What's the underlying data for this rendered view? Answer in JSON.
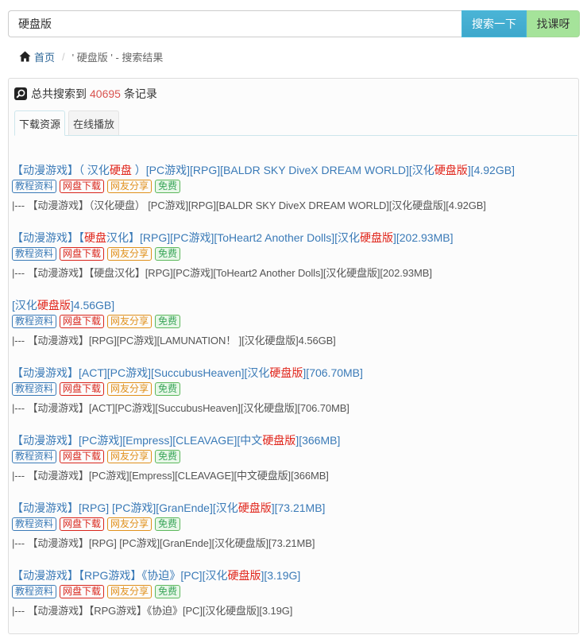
{
  "search": {
    "value": "硬盘版",
    "search_button": "搜索一下",
    "course_button": "找课呀"
  },
  "breadcrumb": {
    "home_label": "首页",
    "separator": "/",
    "current": "' 硬盘版 ' - 搜索结果"
  },
  "summary": {
    "prefix": "总共搜索到",
    "count": "40695",
    "suffix": "条记录"
  },
  "tabs": [
    {
      "label": "下载资源",
      "active": true
    },
    {
      "label": "在线播放",
      "active": false
    }
  ],
  "tag_labels": {
    "tutorial": "教程资料",
    "netdisk": "网盘下载",
    "share": "网友分享",
    "free": "免费"
  },
  "results": [
    {
      "title_pre": "【动漫游戏】（ 汉化",
      "title_hl": "硬盘",
      "title_post": " ）[PC游戏][RPG][BALDR SKY DiveX DREAM WORLD][汉化",
      "title_hl2": "硬盘版",
      "title_post2": "][4.92GB]",
      "desc": "|--- 【动漫游戏】（汉化硬盘） [PC游戏][RPG][BALDR SKY DiveX DREAM WORLD][汉化硬盘版][4.92GB]"
    },
    {
      "title_pre": "【动漫游戏】【",
      "title_hl": "硬盘",
      "title_post": "汉化】[RPG][PC游戏][ToHeart2 Another Dolls][汉化",
      "title_hl2": "硬盘版",
      "title_post2": "][202.93MB]",
      "desc": "|--- 【动漫游戏】【硬盘汉化】[RPG][PC游戏][ToHeart2 Another Dolls][汉化硬盘版][202.93MB]"
    },
    {
      "title_pre": "[汉化",
      "title_hl": "硬盘版",
      "title_post": "]4.56GB]",
      "title_hl2": "",
      "title_post2": "",
      "desc": "|--- 【动漫游戏】[RPG][PC游戏][LAMUNATION！ ][汉化硬盘版]4.56GB]"
    },
    {
      "title_pre": "【动漫游戏】[ACT][PC游戏][SuccubusHeaven][汉化",
      "title_hl": "硬盘版",
      "title_post": "][706.70MB]",
      "title_hl2": "",
      "title_post2": "",
      "desc": "|--- 【动漫游戏】[ACT][PC游戏][SuccubusHeaven][汉化硬盘版][706.70MB]"
    },
    {
      "title_pre": "【动漫游戏】[PC游戏][Empress][CLEAVAGE][中文",
      "title_hl": "硬盘版",
      "title_post": "][366MB]",
      "title_hl2": "",
      "title_post2": "",
      "desc": "|--- 【动漫游戏】[PC游戏][Empress][CLEAVAGE][中文硬盘版][366MB]"
    },
    {
      "title_pre": "【动漫游戏】[RPG] [PC游戏][GranEnde][汉化",
      "title_hl": "硬盘版",
      "title_post": "][73.21MB]",
      "title_hl2": "",
      "title_post2": "",
      "desc": "|--- 【动漫游戏】[RPG] [PC游戏][GranEnde][汉化硬盘版][73.21MB]"
    },
    {
      "title_pre": "【动漫游戏】【RPG游戏】《协迫》[PC][汉化",
      "title_hl": "硬盘版",
      "title_post": "][3.19G]",
      "title_hl2": "",
      "title_post2": "",
      "desc": "|--- 【动漫游戏】【RPG游戏】《协迫》[PC][汉化硬盘版][3.19G]"
    }
  ]
}
